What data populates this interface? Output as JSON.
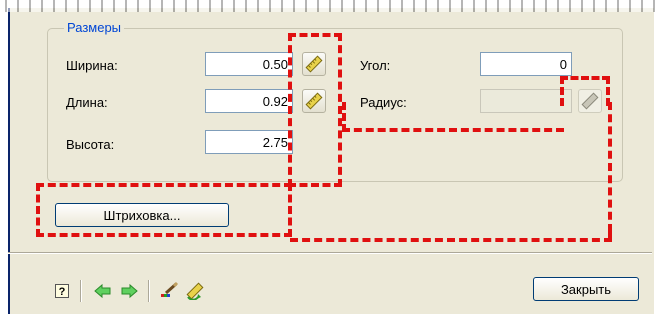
{
  "group": {
    "title": "Размеры"
  },
  "fields": {
    "width": {
      "label": "Ширина:",
      "value": "0.50"
    },
    "length": {
      "label": "Длина:",
      "value": "0.92"
    },
    "height": {
      "label": "Высота:",
      "value": "2.75"
    },
    "angle": {
      "label": "Угол:",
      "value": "0"
    },
    "radius": {
      "label": "Радиус:",
      "value": ""
    }
  },
  "buttons": {
    "hatch": "Штриховка...",
    "close": "Закрыть"
  },
  "icons": {
    "pick": "ruler-pick-icon",
    "help": "help-icon",
    "back": "arrow-left-icon",
    "forward": "arrow-right-icon",
    "brush": "brush-icon",
    "refresh": "refresh-ruler-icon"
  },
  "colors": {
    "highlight": "#e01010",
    "group_title": "#0046d5",
    "panel": "#ece9d8",
    "arrow": "#33b033"
  }
}
